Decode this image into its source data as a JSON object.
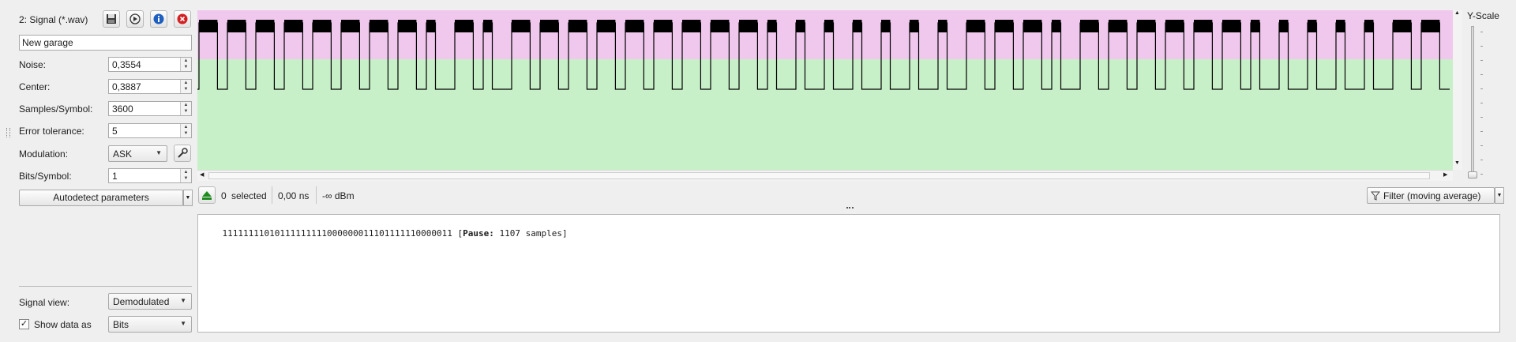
{
  "panel": {
    "title": "2:  Signal (*.wav)",
    "name_value": "New garage",
    "noise_label": "Noise:",
    "noise_value": "0,3554",
    "center_label": "Center:",
    "center_value": "0,3887",
    "sps_label": "Samples/Symbol:",
    "sps_value": "3600",
    "tolerance_label": "Error tolerance:",
    "tolerance_value": "5",
    "modulation_label": "Modulation:",
    "modulation_value": "ASK",
    "bits_label": "Bits/Symbol:",
    "bits_value": "1",
    "autodetect_label": "Autodetect parameters",
    "signal_view_label": "Signal view:",
    "signal_view_value": "Demodulated",
    "show_data_label": "Show data as",
    "show_data_value": "Bits",
    "show_data_checked": true
  },
  "toolbar_icons": [
    "save-icon",
    "play-icon",
    "info-icon",
    "close-icon"
  ],
  "yscale": {
    "label": "Y-Scale"
  },
  "status": {
    "selected_count": "0",
    "selected_label": "selected",
    "duration": "0,00 ns",
    "power": "-∞ dBm",
    "filter_label": "Filter (moving average)"
  },
  "output": {
    "bits": "11111111010111111111000000011101111110000011",
    "pause_open": " [",
    "pause_label": "Pause:",
    "pause_value": " 1107 samples]"
  },
  "colors": {
    "noise_band": "#f0c8ee",
    "signal_band": "#c8f0c8",
    "waveform": "#000000"
  },
  "waveform": {
    "pulse_count": 44,
    "bits": [
      1,
      1,
      1,
      1,
      1,
      1,
      1,
      1,
      0,
      1,
      0,
      1,
      1,
      1,
      1,
      1,
      1,
      1,
      1,
      1,
      0,
      0,
      0,
      0,
      0,
      0,
      0,
      1,
      1,
      1,
      0,
      1,
      1,
      1,
      1,
      1,
      1,
      0,
      0,
      0,
      0,
      0,
      1,
      1
    ]
  }
}
